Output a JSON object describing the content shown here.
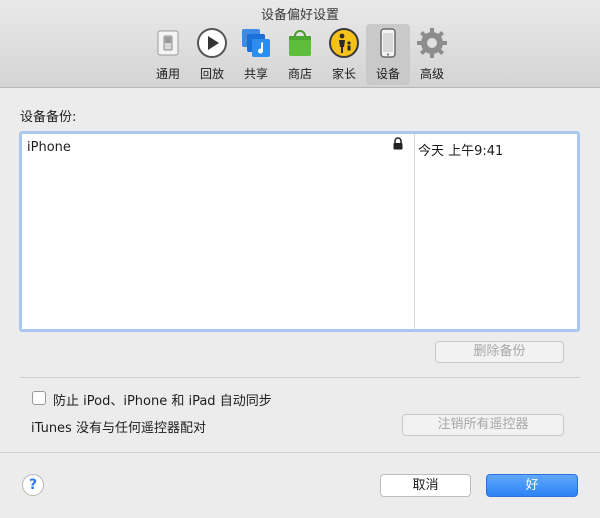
{
  "window": {
    "title": "设备偏好设置"
  },
  "toolbar": {
    "items": [
      {
        "label": "通用",
        "icon": "switch-icon"
      },
      {
        "label": "回放",
        "icon": "play-icon"
      },
      {
        "label": "共享",
        "icon": "music-share-icon"
      },
      {
        "label": "商店",
        "icon": "store-bag-icon"
      },
      {
        "label": "家长",
        "icon": "parental-icon"
      },
      {
        "label": "设备",
        "icon": "device-icon",
        "selected": true
      },
      {
        "label": "高级",
        "icon": "gear-icon"
      }
    ]
  },
  "backups": {
    "label": "设备备份:",
    "rows": [
      {
        "name": "iPhone",
        "locked": true,
        "date": "今天 上午9:41"
      }
    ],
    "delete_label": "删除备份"
  },
  "sync": {
    "prevent_label": "防止 iPod、iPhone 和 iPad 自动同步",
    "checked": false
  },
  "remotes": {
    "status": "iTunes 没有与任何遥控器配对",
    "reset_label": "注销所有遥控器"
  },
  "footer": {
    "help": "?",
    "cancel_label": "取消",
    "ok_label": "好"
  },
  "colors": {
    "accent": "#2c82f5",
    "selection_border": "#a8c8ee"
  }
}
